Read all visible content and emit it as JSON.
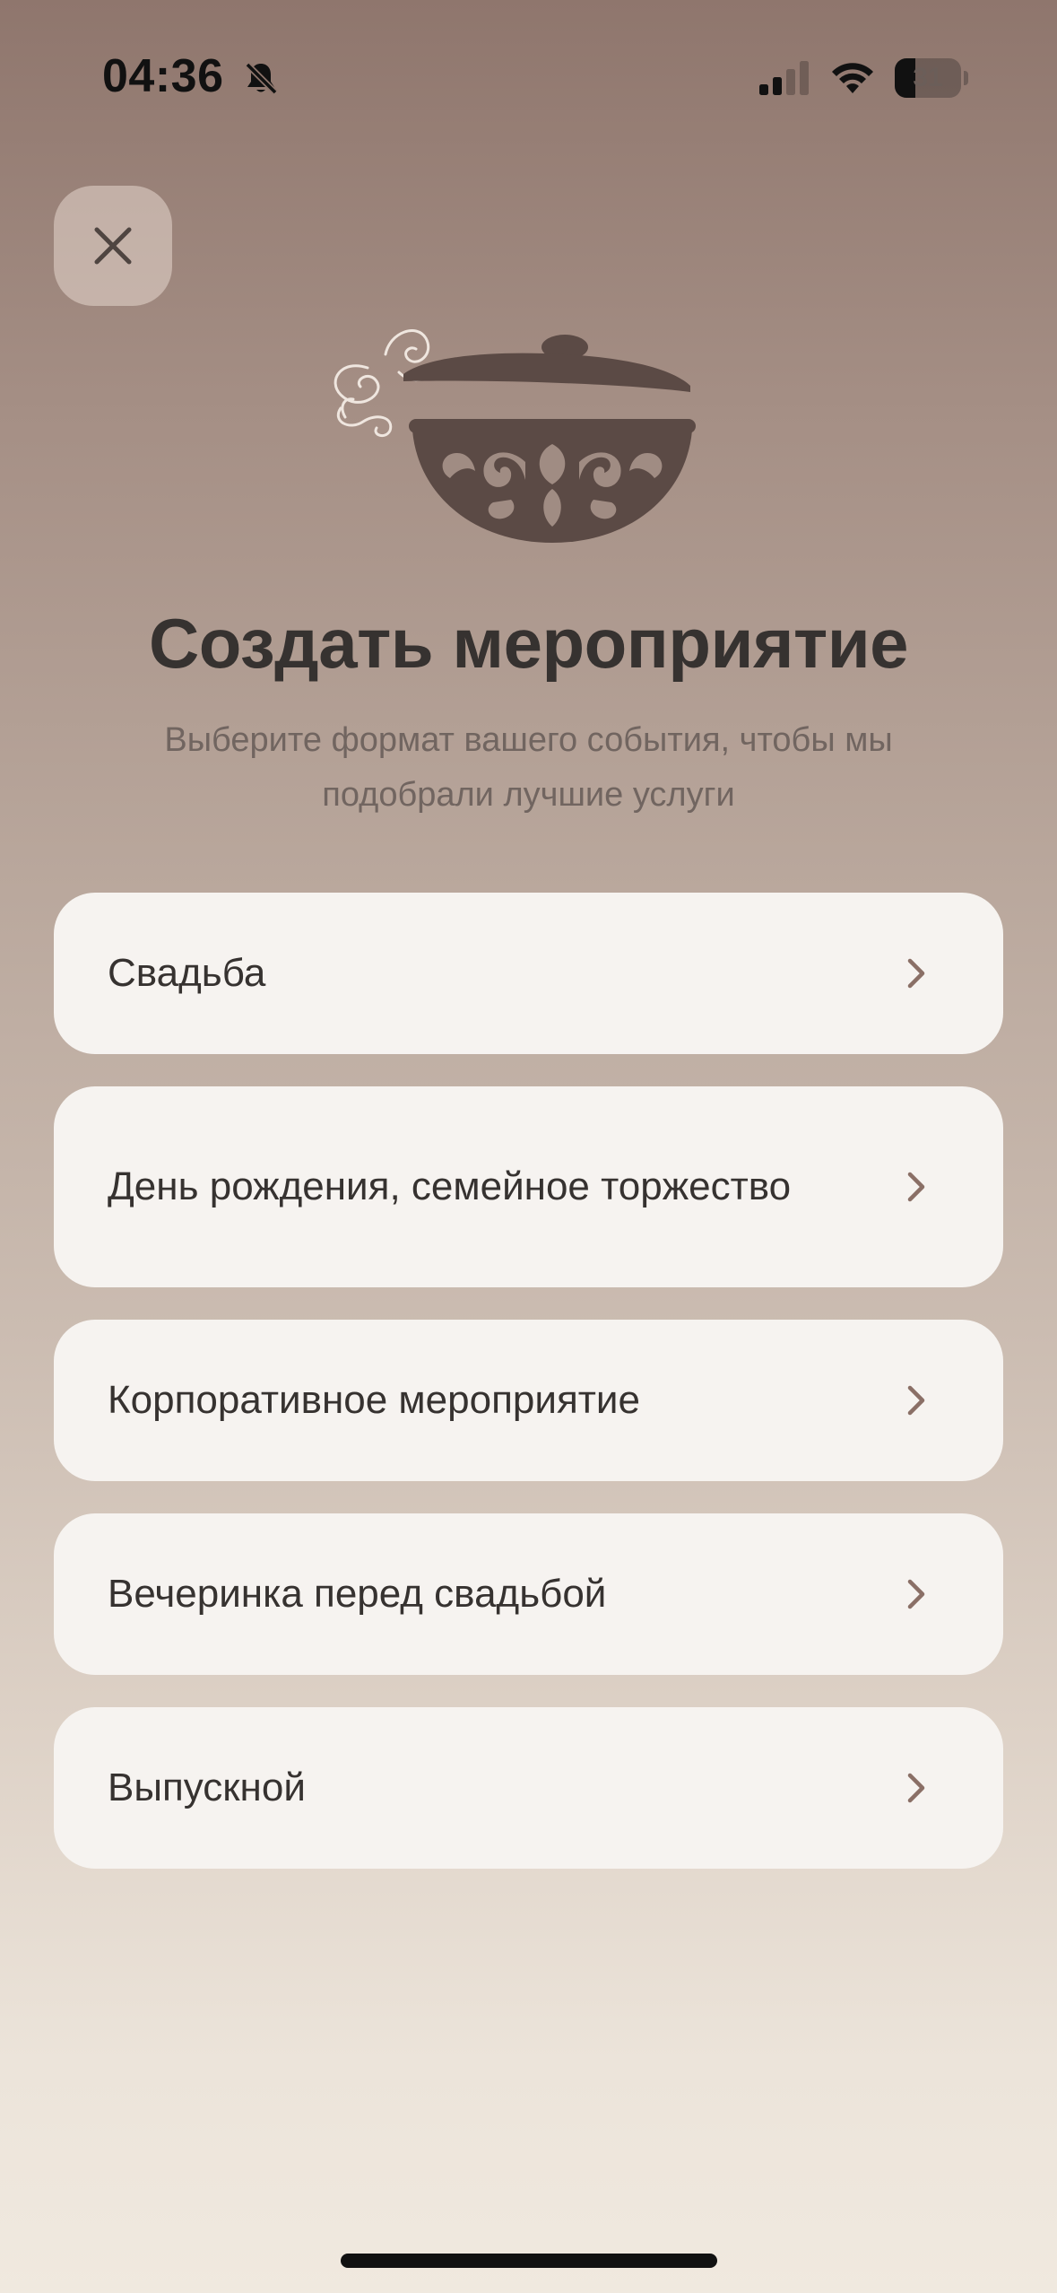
{
  "status_bar": {
    "time": "04:36",
    "battery_level": "31",
    "battery_fraction": 0.31,
    "icons": [
      "bell-slash-icon",
      "cellular-signal-icon",
      "wifi-icon",
      "battery-icon"
    ]
  },
  "header": {
    "close_icon": "close-icon",
    "illustration": "cooking-pot-illustration"
  },
  "page": {
    "title": "Создать мероприятие",
    "subtitle": "Выберите формат вашего события, чтобы мы подобрали лучшие услуги"
  },
  "options": [
    {
      "label": "Свадьба",
      "icon": "chevron-right-icon"
    },
    {
      "label": "День рождения, семейное торжество",
      "icon": "chevron-right-icon"
    },
    {
      "label": "Корпоративное мероприятие",
      "icon": "chevron-right-icon"
    },
    {
      "label": "Вечеринка перед свадьбой",
      "icon": "chevron-right-icon"
    },
    {
      "label": "Выпускной",
      "icon": "chevron-right-icon"
    }
  ],
  "colors": {
    "background_top": "#8f766d",
    "background_bottom": "#f0e9df",
    "card_background": "#f6f3f0",
    "title_text": "#363230",
    "subtitle_text": "#716560",
    "chevron": "#8a6f66",
    "illustration": "#5b4a45"
  }
}
